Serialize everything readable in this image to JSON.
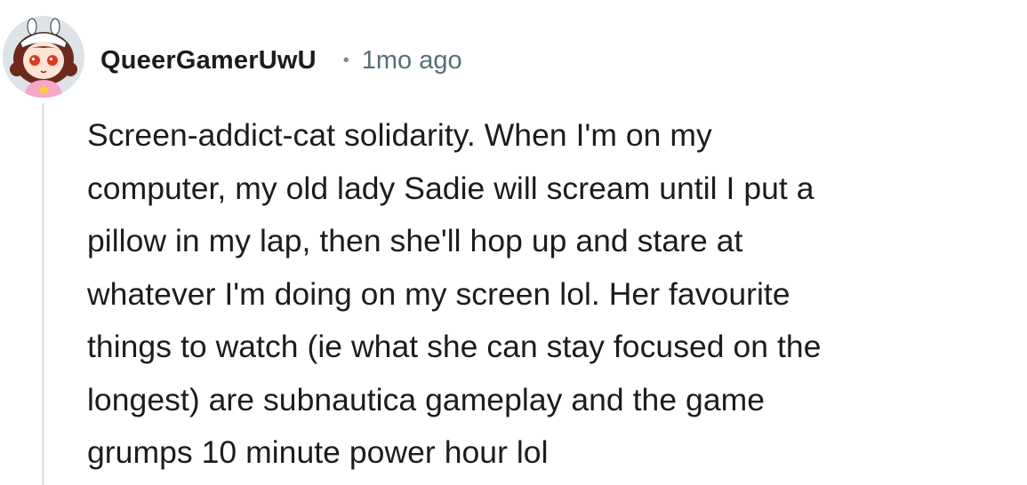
{
  "comment": {
    "username": "QueerGamerUwU",
    "separator": "•",
    "timestamp": "1mo ago",
    "avatar_icon": "cartoon-avatar-icon",
    "body_lines": [
      "Screen-addict-cat solidarity. When I'm on my",
      "computer, my old lady Sadie will scream until I put a",
      "pillow in my lap, then she'll hop up and stare at",
      "whatever I'm doing on my screen lol. Her favourite",
      "things to watch (ie what she can stay focused on the",
      "longest) are subnautica gameplay and the game",
      "grumps 10 minute power hour lol"
    ]
  },
  "colors": {
    "text": "#1c1c1c",
    "meta": "#576f76",
    "thread_line": "#e4e6e8",
    "avatar_bg": "#dde3e7"
  }
}
